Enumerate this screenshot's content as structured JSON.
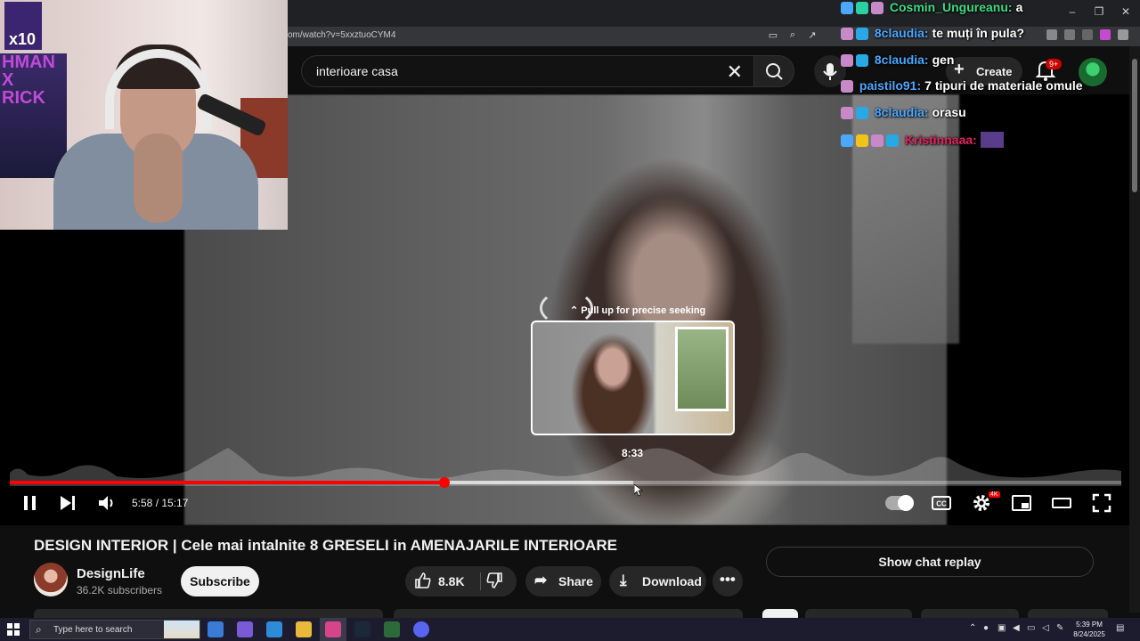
{
  "browser": {
    "url": "om/watch?v=5xxztuoCYM4",
    "window_controls": [
      "–",
      "❐",
      "✕"
    ]
  },
  "youtube_header": {
    "search_value": "interioare casa",
    "create_label": "Create",
    "notification_badge": "9+"
  },
  "player": {
    "seek_hint": "Pull up for precise seeking",
    "preview_time": "8:33",
    "time_display": "5:58 / 15:17",
    "progress_fraction": 0.391,
    "hover_fraction": 0.561,
    "quality_badge": "4K"
  },
  "video": {
    "title": "DESIGN INTERIOR | Cele mai intalnite 8 GRESELI in AMENAJARILE INTERIOARE",
    "channel_name": "DesignLife",
    "subscribers": "36.2K subscribers",
    "subscribe_label": "Subscribe",
    "likes": "8.8K",
    "share_label": "Share",
    "download_label": "Download",
    "chat_replay_label": "Show chat replay"
  },
  "facecam": {
    "badge_text": "x10",
    "poster_text": "HMAN\nX\nRICK"
  },
  "chat": [
    {
      "user": "Cosmin_Ungureanu:",
      "message": "a",
      "color": "#3ddc84"
    },
    {
      "user": "8claudia:",
      "message": "te muți în pula?",
      "color": "#4aa8ff"
    },
    {
      "user": "8claudia:",
      "message": "gen",
      "color": "#4aa8ff"
    },
    {
      "user": "paistilo91:",
      "message": "7 tipuri de materiale omule",
      "color": "#4aa8ff"
    },
    {
      "user": "8claudia:",
      "message": "orasu",
      "color": "#4aa8ff"
    },
    {
      "user": "Kristinnaaa:",
      "message": "",
      "color": "#e0245e"
    }
  ],
  "taskbar": {
    "search_placeholder": "Type here to search",
    "time": "5:39 PM",
    "date": "8/24/2025"
  },
  "colors": {
    "accent_red": "#ff0000",
    "background": "#0f0f0f",
    "pill": "#272727"
  }
}
